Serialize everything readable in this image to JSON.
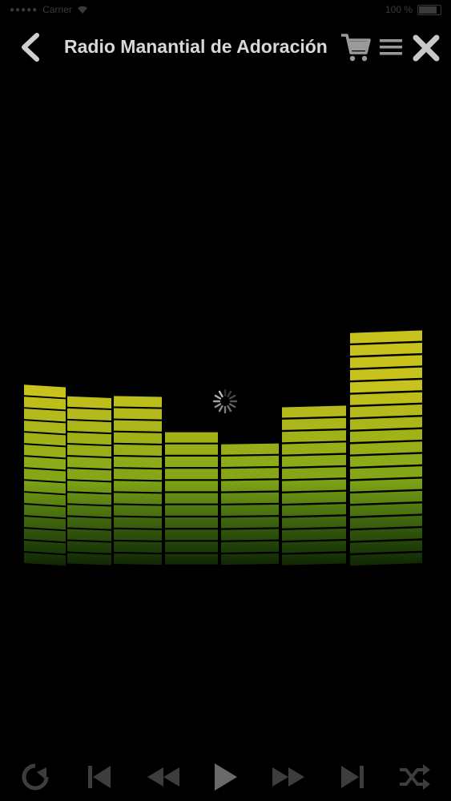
{
  "status_bar": {
    "carrier": "Carrier",
    "signal": "●●●●●",
    "battery_percent": "100 %"
  },
  "header": {
    "title": "Radio Manantial de Adoración"
  },
  "icons": {
    "back": "back-chevron-icon",
    "cart": "cart-icon",
    "menu": "menu-icon",
    "close": "close-icon",
    "spinner": "loading-spinner-icon",
    "repeat": "repeat-icon",
    "previous": "skip-previous-icon",
    "rewind": "rewind-icon",
    "play": "play-icon",
    "fast_forward": "fast-forward-icon",
    "next": "skip-next-icon",
    "shuffle": "shuffle-icon"
  },
  "colors": {
    "background": "#000000",
    "bar_top": "#c8c21c",
    "bar_bottom": "#3f8a12",
    "icon_color": "#9a9a9a",
    "control_color": "#3d3d3d"
  },
  "equalizer": {
    "levels": [
      10,
      9,
      9,
      6,
      5,
      8,
      14
    ]
  }
}
